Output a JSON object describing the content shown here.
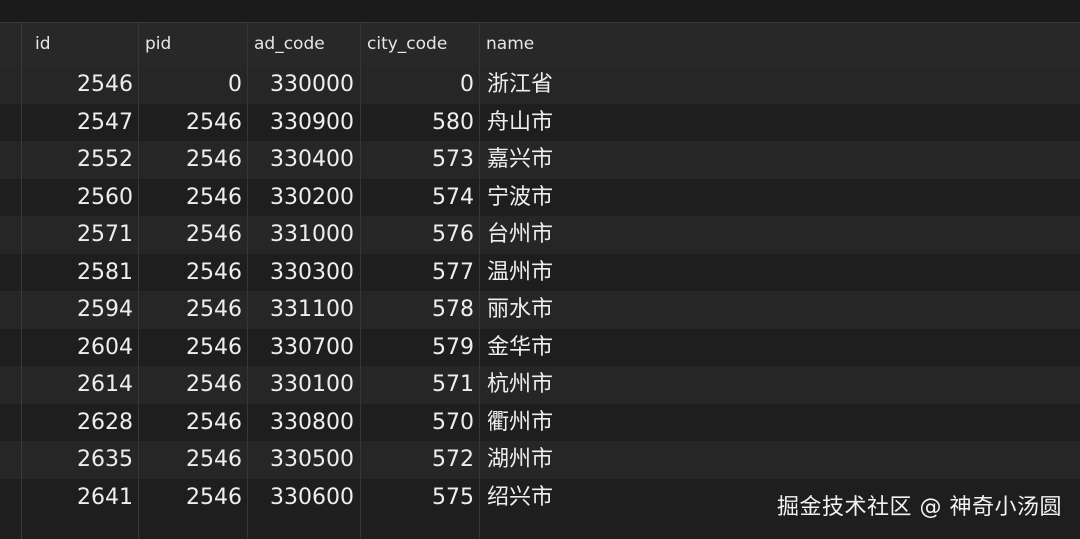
{
  "columns": [
    "id",
    "pid",
    "ad_code",
    "city_code",
    "name"
  ],
  "rows": [
    {
      "id": "2546",
      "pid": "0",
      "ad_code": "330000",
      "city_code": "0",
      "name": "浙江省"
    },
    {
      "id": "2547",
      "pid": "2546",
      "ad_code": "330900",
      "city_code": "580",
      "name": "舟山市"
    },
    {
      "id": "2552",
      "pid": "2546",
      "ad_code": "330400",
      "city_code": "573",
      "name": "嘉兴市"
    },
    {
      "id": "2560",
      "pid": "2546",
      "ad_code": "330200",
      "city_code": "574",
      "name": "宁波市"
    },
    {
      "id": "2571",
      "pid": "2546",
      "ad_code": "331000",
      "city_code": "576",
      "name": "台州市"
    },
    {
      "id": "2581",
      "pid": "2546",
      "ad_code": "330300",
      "city_code": "577",
      "name": "温州市"
    },
    {
      "id": "2594",
      "pid": "2546",
      "ad_code": "331100",
      "city_code": "578",
      "name": "丽水市"
    },
    {
      "id": "2604",
      "pid": "2546",
      "ad_code": "330700",
      "city_code": "579",
      "name": "金华市"
    },
    {
      "id": "2614",
      "pid": "2546",
      "ad_code": "330100",
      "city_code": "571",
      "name": "杭州市"
    },
    {
      "id": "2628",
      "pid": "2546",
      "ad_code": "330800",
      "city_code": "570",
      "name": "衢州市"
    },
    {
      "id": "2635",
      "pid": "2546",
      "ad_code": "330500",
      "city_code": "572",
      "name": "湖州市"
    },
    {
      "id": "2641",
      "pid": "2546",
      "ad_code": "330600",
      "city_code": "575",
      "name": "绍兴市"
    }
  ],
  "watermark": "掘金技术社区 @ 神奇小汤圆",
  "colors": {
    "background": "#1e1e1e",
    "header": "#282828",
    "row_alt": "#262626",
    "text": "#eeeeee"
  }
}
